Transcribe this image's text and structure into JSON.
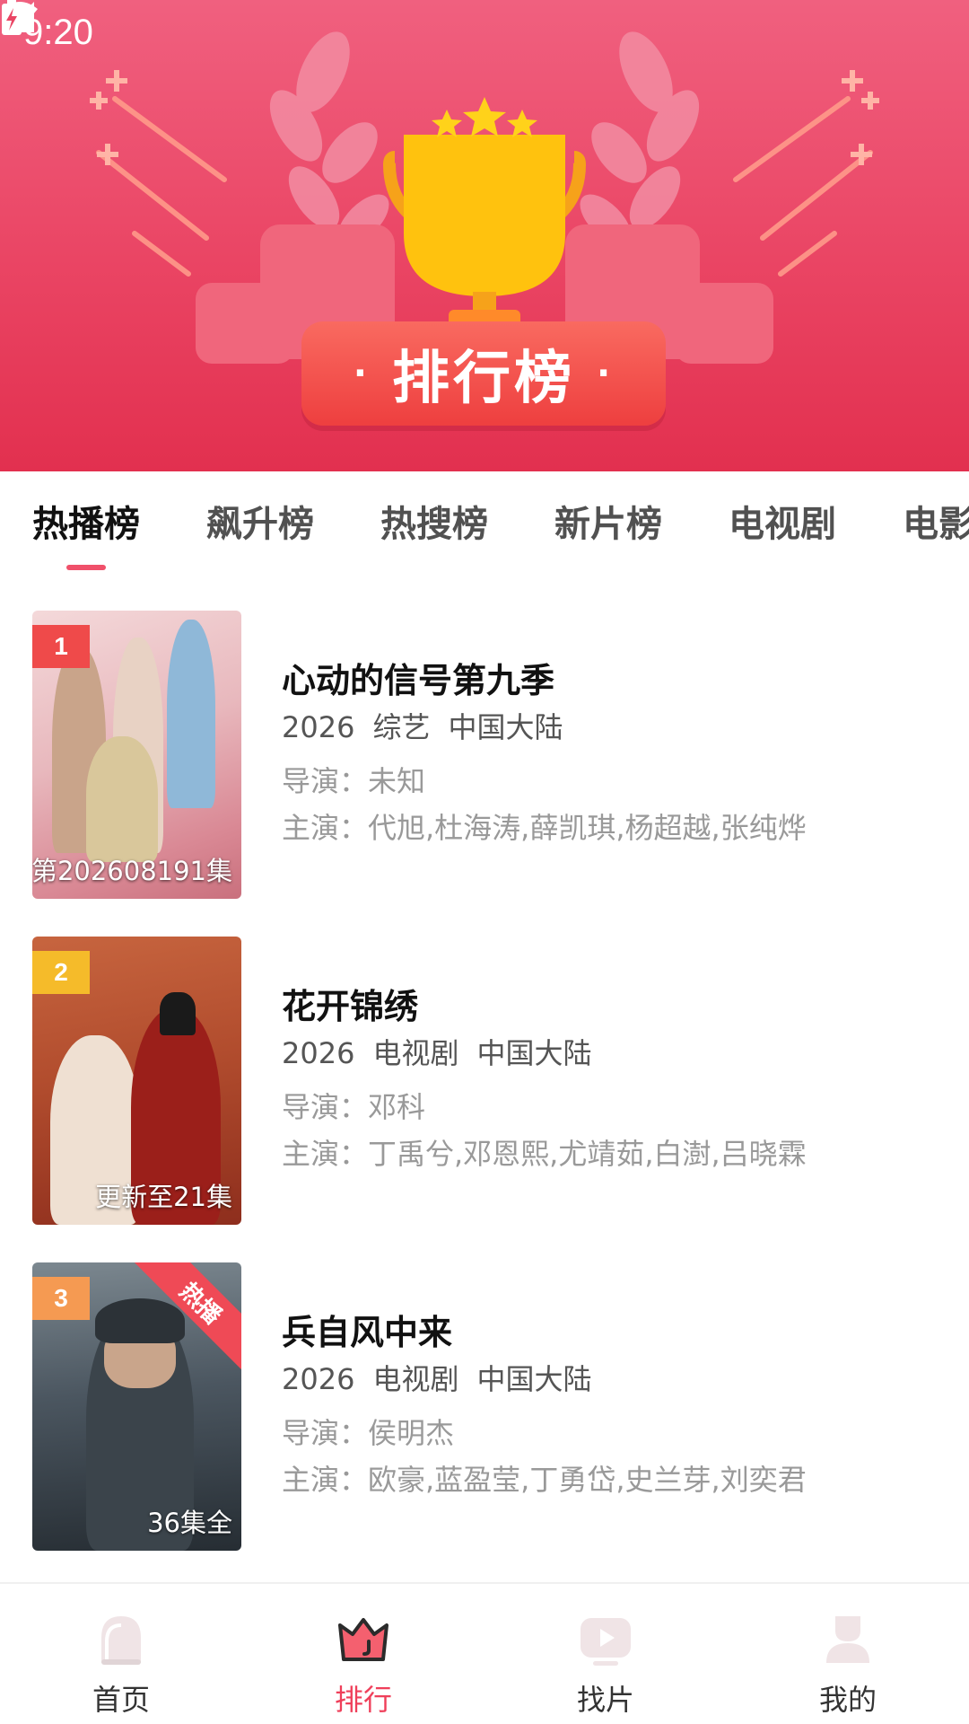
{
  "status_bar": {
    "time": "9:20"
  },
  "banner": {
    "title": "排行榜"
  },
  "tabs": [
    {
      "label": "热播榜",
      "active": true
    },
    {
      "label": "飙升榜",
      "active": false
    },
    {
      "label": "热搜榜",
      "active": false
    },
    {
      "label": "新片榜",
      "active": false
    },
    {
      "label": "电视剧",
      "active": false
    },
    {
      "label": "电影",
      "active": false
    }
  ],
  "items": [
    {
      "rank": "1",
      "title": "心动的信号第九季",
      "year": "2026",
      "genre": "综艺",
      "region": "中国大陆",
      "director": "导演：未知",
      "cast": "主演：代旭,杜海涛,薛凯琪,杨超越,张纯烨",
      "caption": "第202608191集",
      "hot": ""
    },
    {
      "rank": "2",
      "title": "花开锦绣",
      "year": "2026",
      "genre": "电视剧",
      "region": "中国大陆",
      "director": "导演：邓科",
      "cast": "主演：丁禹兮,邓恩熙,尤靖茹,白澍,吕晓霖",
      "caption": "更新至21集",
      "hot": ""
    },
    {
      "rank": "3",
      "title": "兵自风中来",
      "year": "2026",
      "genre": "电视剧",
      "region": "中国大陆",
      "director": "导演：侯明杰",
      "cast": "主演：欧豪,蓝盈莹,丁勇岱,史兰芽,刘奕君",
      "caption": "36集全",
      "hot": "热播"
    }
  ],
  "bottom_nav": [
    {
      "label": "首页",
      "icon": "home-icon",
      "active": false
    },
    {
      "label": "排行",
      "icon": "crown-icon",
      "active": true
    },
    {
      "label": "找片",
      "icon": "play-screen-icon",
      "active": false
    },
    {
      "label": "我的",
      "icon": "profile-icon",
      "active": false
    }
  ],
  "colors": {
    "accent": "#ef3f5a",
    "banner": "#ea4564"
  }
}
